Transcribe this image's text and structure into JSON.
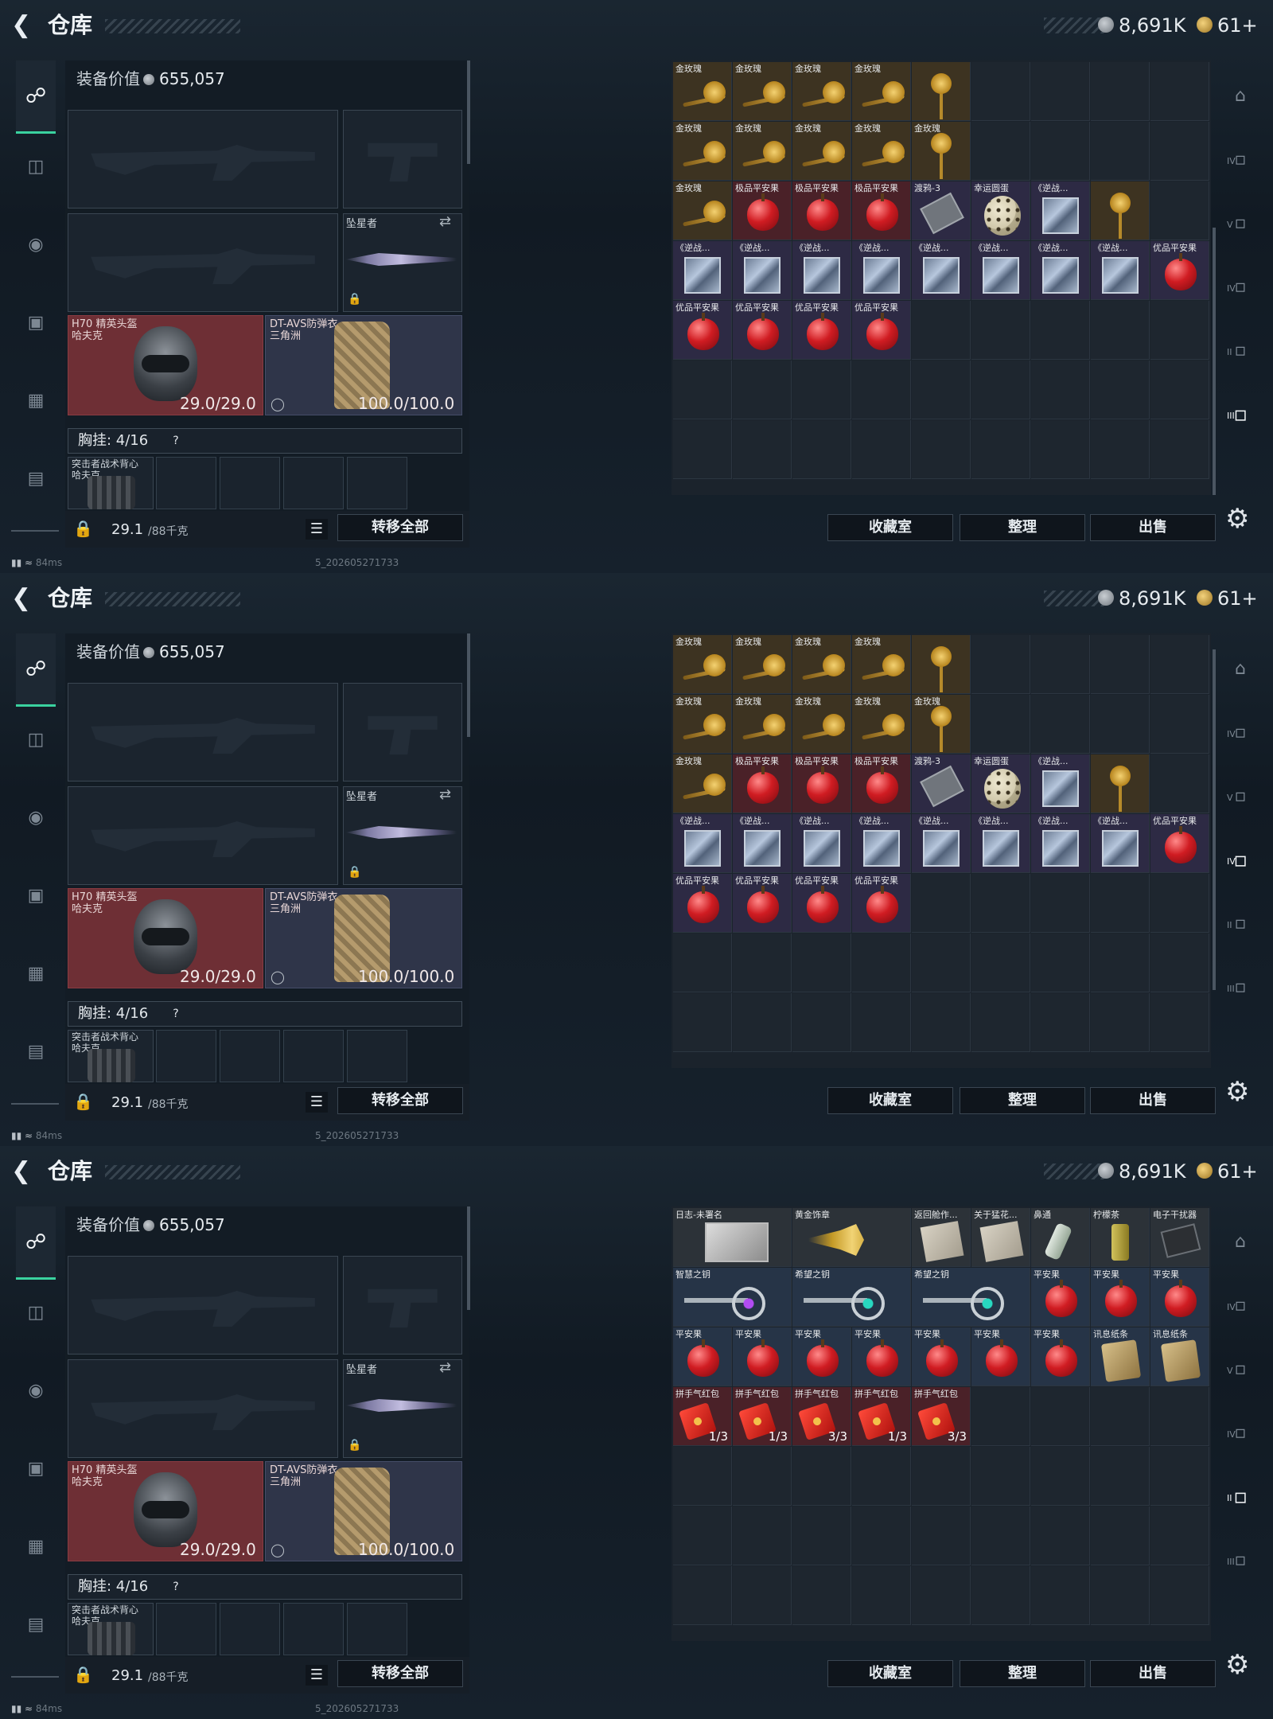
{
  "topbar": {
    "back_icon": "back-arrow-icon",
    "title": "仓库",
    "currency1_icon": "silver-coin-icon",
    "currency1": "8,691K",
    "currency2_icon": "gold-coin-icon",
    "currency2": "61+"
  },
  "equipment": {
    "value_label": "装备价值",
    "value": "655,057",
    "melee_label": "坠星者",
    "helmet": {
      "name": "H70 精英头盔",
      "sub": "哈夫克",
      "durability": "29.0/29.0"
    },
    "armor": {
      "name": "DT-AVS防弹衣",
      "sub": "三角洲",
      "durability": "100.0/100.0"
    },
    "chest_label": "胸挂: 4/16",
    "help": "?",
    "vest": {
      "name": "突击者战术背心",
      "sub": "哈夫克"
    },
    "weight": "29.1",
    "weight_max": "/88千克",
    "transfer_all": "转移全部"
  },
  "status": {
    "ping": "84ms",
    "build": "5_202605271733"
  },
  "buttons": {
    "collection": "收藏室",
    "sort": "整理",
    "sell": "出售"
  },
  "colors": {
    "accent": "#3ad29f",
    "quality_gold": "#3d3321",
    "quality_red": "#4a2128",
    "quality_purple": "#2d2a44"
  },
  "screens": [
    {
      "grid": [
        [
          {
            "name": "金玫瑰",
            "q": "q-gold",
            "icon": "rose-icon"
          },
          {
            "name": "金玫瑰",
            "q": "q-gold",
            "icon": "rose-icon"
          },
          {
            "name": "金玫瑰",
            "q": "q-gold",
            "icon": "rose-icon"
          },
          {
            "name": "金玫瑰",
            "q": "q-gold",
            "icon": "rose-icon"
          },
          {
            "name": "",
            "q": "q-gold",
            "icon": "rose-tall-icon"
          }
        ],
        [
          {
            "name": "金玫瑰",
            "q": "q-gold",
            "icon": "rose-icon"
          },
          {
            "name": "金玫瑰",
            "q": "q-gold",
            "icon": "rose-icon"
          },
          {
            "name": "金玫瑰",
            "q": "q-gold",
            "icon": "rose-icon"
          },
          {
            "name": "金玫瑰",
            "q": "q-gold",
            "icon": "rose-icon"
          },
          {
            "name": "金玫瑰",
            "q": "q-gold",
            "icon": "rose-tall-icon"
          }
        ],
        [
          {
            "name": "金玫瑰",
            "q": "q-gold",
            "icon": "rose-icon"
          },
          {
            "name": "极品平安果",
            "q": "q-red",
            "icon": "apple-icon"
          },
          {
            "name": "极品平安果",
            "q": "q-red",
            "icon": "apple-icon"
          },
          {
            "name": "极品平安果",
            "q": "q-red",
            "icon": "apple-icon"
          },
          {
            "name": "渡鸦-3",
            "q": "q-purple",
            "icon": "card-icon"
          },
          {
            "name": "幸运圆蛋",
            "q": "q-purple",
            "icon": "egg-icon"
          },
          {
            "name": "《逆战...",
            "q": "q-purple",
            "icon": "cube-icon"
          },
          {
            "name": "",
            "q": "q-gold",
            "icon": "rose-tall-icon"
          }
        ],
        [
          {
            "name": "《逆战...",
            "q": "q-purple",
            "icon": "cube-icon"
          },
          {
            "name": "《逆战...",
            "q": "q-purple",
            "icon": "cube-icon"
          },
          {
            "name": "《逆战...",
            "q": "q-purple",
            "icon": "cube-icon"
          },
          {
            "name": "《逆战...",
            "q": "q-purple",
            "icon": "cube-icon"
          },
          {
            "name": "《逆战...",
            "q": "q-purple",
            "icon": "cube-icon"
          },
          {
            "name": "《逆战...",
            "q": "q-purple",
            "icon": "cube-icon"
          },
          {
            "name": "《逆战...",
            "q": "q-purple",
            "icon": "cube-icon"
          },
          {
            "name": "《逆战...",
            "q": "q-purple",
            "icon": "cube-icon"
          },
          {
            "name": "优品平安果",
            "q": "q-purple",
            "icon": "apple-icon"
          }
        ],
        [
          {
            "name": "优品平安果",
            "q": "q-purple",
            "icon": "apple-icon"
          },
          {
            "name": "优品平安果",
            "q": "q-purple",
            "icon": "apple-icon"
          },
          {
            "name": "优品平安果",
            "q": "q-purple",
            "icon": "apple-icon"
          },
          {
            "name": "优品平安果",
            "q": "q-purple",
            "icon": "apple-icon"
          }
        ]
      ],
      "rightbar_active": 5
    },
    {
      "grid": [
        [
          {
            "name": "金玫瑰",
            "q": "q-gold",
            "icon": "rose-icon"
          },
          {
            "name": "金玫瑰",
            "q": "q-gold",
            "icon": "rose-icon"
          },
          {
            "name": "金玫瑰",
            "q": "q-gold",
            "icon": "rose-icon"
          },
          {
            "name": "金玫瑰",
            "q": "q-gold",
            "icon": "rose-icon"
          },
          {
            "name": "",
            "q": "q-gold",
            "icon": "rose-tall-icon"
          }
        ],
        [
          {
            "name": "金玫瑰",
            "q": "q-gold",
            "icon": "rose-icon"
          },
          {
            "name": "金玫瑰",
            "q": "q-gold",
            "icon": "rose-icon"
          },
          {
            "name": "金玫瑰",
            "q": "q-gold",
            "icon": "rose-icon"
          },
          {
            "name": "金玫瑰",
            "q": "q-gold",
            "icon": "rose-icon"
          },
          {
            "name": "金玫瑰",
            "q": "q-gold",
            "icon": "rose-tall-icon"
          }
        ],
        [
          {
            "name": "金玫瑰",
            "q": "q-gold",
            "icon": "rose-icon"
          },
          {
            "name": "极品平安果",
            "q": "q-red",
            "icon": "apple-icon"
          },
          {
            "name": "极品平安果",
            "q": "q-red",
            "icon": "apple-icon"
          },
          {
            "name": "极品平安果",
            "q": "q-red",
            "icon": "apple-icon"
          },
          {
            "name": "渡鸦-3",
            "q": "q-purple",
            "icon": "card-icon"
          },
          {
            "name": "幸运圆蛋",
            "q": "q-purple",
            "icon": "egg-icon"
          },
          {
            "name": "《逆战...",
            "q": "q-purple",
            "icon": "cube-icon"
          },
          {
            "name": "",
            "q": "q-gold",
            "icon": "rose-tall-icon"
          }
        ],
        [
          {
            "name": "《逆战...",
            "q": "q-purple",
            "icon": "cube-icon"
          },
          {
            "name": "《逆战...",
            "q": "q-purple",
            "icon": "cube-icon"
          },
          {
            "name": "《逆战...",
            "q": "q-purple",
            "icon": "cube-icon"
          },
          {
            "name": "《逆战...",
            "q": "q-purple",
            "icon": "cube-icon"
          },
          {
            "name": "《逆战...",
            "q": "q-purple",
            "icon": "cube-icon"
          },
          {
            "name": "《逆战...",
            "q": "q-purple",
            "icon": "cube-icon"
          },
          {
            "name": "《逆战...",
            "q": "q-purple",
            "icon": "cube-icon"
          },
          {
            "name": "《逆战...",
            "q": "q-purple",
            "icon": "cube-icon"
          },
          {
            "name": "优品平安果",
            "q": "q-purple",
            "icon": "apple-icon"
          }
        ],
        [
          {
            "name": "优品平安果",
            "q": "q-purple",
            "icon": "apple-icon"
          },
          {
            "name": "优品平安果",
            "q": "q-purple",
            "icon": "apple-icon"
          },
          {
            "name": "优品平安果",
            "q": "q-purple",
            "icon": "apple-icon"
          },
          {
            "name": "优品平安果",
            "q": "q-purple",
            "icon": "apple-icon"
          }
        ]
      ],
      "rightbar_active": 3
    },
    {
      "grid": [
        [
          {
            "name": "日志-未署名",
            "q": "q-gray",
            "icon": "photo-icon",
            "wide": true
          },
          {
            "name": "黄金饰章",
            "q": "q-gray",
            "icon": "badge-icon",
            "wide": true
          },
          {
            "name": "返回舱作...",
            "q": "q-gray",
            "icon": "doc-icon"
          },
          {
            "name": "关于猛花...",
            "q": "q-gray",
            "icon": "doc-icon"
          },
          {
            "name": "鼻通",
            "q": "q-gray",
            "icon": "tube-icon"
          },
          {
            "name": "柠檬茶",
            "q": "q-gray",
            "icon": "can-icon"
          },
          {
            "name": "电子干扰器",
            "q": "q-gray",
            "icon": "device-icon"
          }
        ],
        [
          {
            "name": "智慧之钥",
            "q": "q-blue",
            "icon": "key-icon",
            "wide": true
          },
          {
            "name": "希望之钥",
            "q": "q-blue",
            "icon": "key-icon teal",
            "wide": true
          },
          {
            "name": "希望之钥",
            "q": "q-blue",
            "icon": "key-icon teal",
            "wide": true
          },
          {
            "name": "平安果",
            "q": "q-blue",
            "icon": "apple-icon"
          },
          {
            "name": "平安果",
            "q": "q-blue",
            "icon": "apple-icon"
          },
          {
            "name": "平安果",
            "q": "q-blue",
            "icon": "apple-icon"
          }
        ],
        [
          {
            "name": "平安果",
            "q": "q-blue",
            "icon": "apple-icon"
          },
          {
            "name": "平安果",
            "q": "q-blue",
            "icon": "apple-icon"
          },
          {
            "name": "平安果",
            "q": "q-blue",
            "icon": "apple-icon"
          },
          {
            "name": "平安果",
            "q": "q-blue",
            "icon": "apple-icon"
          },
          {
            "name": "平安果",
            "q": "q-blue",
            "icon": "apple-icon"
          },
          {
            "name": "平安果",
            "q": "q-blue",
            "icon": "apple-icon"
          },
          {
            "name": "平安果",
            "q": "q-blue",
            "icon": "apple-icon"
          },
          {
            "name": "讯息纸条",
            "q": "q-blue",
            "icon": "scroll-icon"
          },
          {
            "name": "讯息纸条",
            "q": "q-blue",
            "icon": "scroll-icon"
          }
        ],
        [
          {
            "name": "拼手气红包",
            "q": "q-red",
            "icon": "envelope-icon",
            "count": "1/3"
          },
          {
            "name": "拼手气红包",
            "q": "q-red",
            "icon": "envelope-icon",
            "count": "1/3"
          },
          {
            "name": "拼手气红包",
            "q": "q-red",
            "icon": "envelope-icon",
            "count": "3/3"
          },
          {
            "name": "拼手气红包",
            "q": "q-red",
            "icon": "envelope-icon",
            "count": "1/3"
          },
          {
            "name": "拼手气红包",
            "q": "q-red",
            "icon": "envelope-icon",
            "count": "3/3"
          }
        ]
      ],
      "rightbar_active": 4
    }
  ],
  "nav_icons": [
    "pistol-icon",
    "vest-icon",
    "helmet-icon",
    "backpack-icon",
    "case-icon",
    "toolbox-icon"
  ],
  "rightbar_icons": [
    "home-storage-icon",
    "storage-tab-4-icon",
    "storage-tab-v-icon",
    "storage-tab-iv-icon",
    "storage-tab-ii-icon",
    "storage-tab-iii-icon",
    "add-tab-icon",
    "lock-tab-icon"
  ]
}
